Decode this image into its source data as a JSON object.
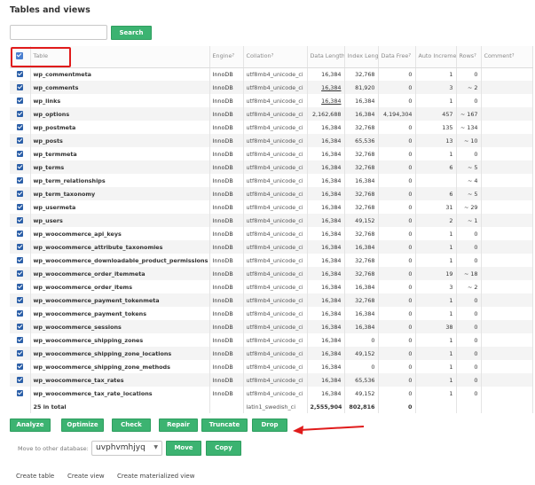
{
  "page": {
    "title": "Tables and views"
  },
  "search": {
    "value": "",
    "placeholder": "",
    "button_label": "Search"
  },
  "table": {
    "headers": {
      "table": "Table",
      "engine": "Engine",
      "collation": "Collation",
      "data_length": "Data Length",
      "index_length": "Index Length",
      "data_free": "Data Free",
      "auto_increment": "Auto Increment",
      "rows": "Rows",
      "comment": "Comment"
    },
    "rows": [
      {
        "name": "wp_commentmeta",
        "engine": "InnoDB",
        "collation": "utf8mb4_unicode_ci",
        "data_length": "16,384",
        "index_length": "32,768",
        "data_free": "0",
        "auto_increment": "1",
        "rows": "0",
        "comment": ""
      },
      {
        "name": "wp_comments",
        "engine": "InnoDB",
        "collation": "utf8mb4_unicode_ci",
        "data_length": "16,384",
        "index_length": "81,920",
        "data_free": "0",
        "auto_increment": "3",
        "rows": "~ 2",
        "comment": ""
      },
      {
        "name": "wp_links",
        "engine": "InnoDB",
        "collation": "utf8mb4_unicode_ci",
        "data_length": "16,384",
        "index_length": "16,384",
        "data_free": "0",
        "auto_increment": "1",
        "rows": "0",
        "comment": ""
      },
      {
        "name": "wp_options",
        "engine": "InnoDB",
        "collation": "utf8mb4_unicode_ci",
        "data_length": "2,162,688",
        "index_length": "16,384",
        "data_free": "4,194,304",
        "auto_increment": "457",
        "rows": "~ 167",
        "comment": ""
      },
      {
        "name": "wp_postmeta",
        "engine": "InnoDB",
        "collation": "utf8mb4_unicode_ci",
        "data_length": "16,384",
        "index_length": "32,768",
        "data_free": "0",
        "auto_increment": "135",
        "rows": "~ 134",
        "comment": ""
      },
      {
        "name": "wp_posts",
        "engine": "InnoDB",
        "collation": "utf8mb4_unicode_ci",
        "data_length": "16,384",
        "index_length": "65,536",
        "data_free": "0",
        "auto_increment": "13",
        "rows": "~ 10",
        "comment": ""
      },
      {
        "name": "wp_termmeta",
        "engine": "InnoDB",
        "collation": "utf8mb4_unicode_ci",
        "data_length": "16,384",
        "index_length": "32,768",
        "data_free": "0",
        "auto_increment": "1",
        "rows": "0",
        "comment": ""
      },
      {
        "name": "wp_terms",
        "engine": "InnoDB",
        "collation": "utf8mb4_unicode_ci",
        "data_length": "16,384",
        "index_length": "32,768",
        "data_free": "0",
        "auto_increment": "6",
        "rows": "~ 5",
        "comment": ""
      },
      {
        "name": "wp_term_relationships",
        "engine": "InnoDB",
        "collation": "utf8mb4_unicode_ci",
        "data_length": "16,384",
        "index_length": "16,384",
        "data_free": "0",
        "auto_increment": "",
        "rows": "~ 4",
        "comment": ""
      },
      {
        "name": "wp_term_taxonomy",
        "engine": "InnoDB",
        "collation": "utf8mb4_unicode_ci",
        "data_length": "16,384",
        "index_length": "32,768",
        "data_free": "0",
        "auto_increment": "6",
        "rows": "~ 5",
        "comment": ""
      },
      {
        "name": "wp_usermeta",
        "engine": "InnoDB",
        "collation": "utf8mb4_unicode_ci",
        "data_length": "16,384",
        "index_length": "32,768",
        "data_free": "0",
        "auto_increment": "31",
        "rows": "~ 29",
        "comment": ""
      },
      {
        "name": "wp_users",
        "engine": "InnoDB",
        "collation": "utf8mb4_unicode_ci",
        "data_length": "16,384",
        "index_length": "49,152",
        "data_free": "0",
        "auto_increment": "2",
        "rows": "~ 1",
        "comment": ""
      },
      {
        "name": "wp_woocommerce_api_keys",
        "engine": "InnoDB",
        "collation": "utf8mb4_unicode_ci",
        "data_length": "16,384",
        "index_length": "32,768",
        "data_free": "0",
        "auto_increment": "1",
        "rows": "0",
        "comment": ""
      },
      {
        "name": "wp_woocommerce_attribute_taxonomies",
        "engine": "InnoDB",
        "collation": "utf8mb4_unicode_ci",
        "data_length": "16,384",
        "index_length": "16,384",
        "data_free": "0",
        "auto_increment": "1",
        "rows": "0",
        "comment": ""
      },
      {
        "name": "wp_woocommerce_downloadable_product_permissions",
        "engine": "InnoDB",
        "collation": "utf8mb4_unicode_ci",
        "data_length": "16,384",
        "index_length": "32,768",
        "data_free": "0",
        "auto_increment": "1",
        "rows": "0",
        "comment": ""
      },
      {
        "name": "wp_woocommerce_order_itemmeta",
        "engine": "InnoDB",
        "collation": "utf8mb4_unicode_ci",
        "data_length": "16,384",
        "index_length": "32,768",
        "data_free": "0",
        "auto_increment": "19",
        "rows": "~ 18",
        "comment": ""
      },
      {
        "name": "wp_woocommerce_order_items",
        "engine": "InnoDB",
        "collation": "utf8mb4_unicode_ci",
        "data_length": "16,384",
        "index_length": "16,384",
        "data_free": "0",
        "auto_increment": "3",
        "rows": "~ 2",
        "comment": ""
      },
      {
        "name": "wp_woocommerce_payment_tokenmeta",
        "engine": "InnoDB",
        "collation": "utf8mb4_unicode_ci",
        "data_length": "16,384",
        "index_length": "32,768",
        "data_free": "0",
        "auto_increment": "1",
        "rows": "0",
        "comment": ""
      },
      {
        "name": "wp_woocommerce_payment_tokens",
        "engine": "InnoDB",
        "collation": "utf8mb4_unicode_ci",
        "data_length": "16,384",
        "index_length": "16,384",
        "data_free": "0",
        "auto_increment": "1",
        "rows": "0",
        "comment": ""
      },
      {
        "name": "wp_woocommerce_sessions",
        "engine": "InnoDB",
        "collation": "utf8mb4_unicode_ci",
        "data_length": "16,384",
        "index_length": "16,384",
        "data_free": "0",
        "auto_increment": "38",
        "rows": "0",
        "comment": ""
      },
      {
        "name": "wp_woocommerce_shipping_zones",
        "engine": "InnoDB",
        "collation": "utf8mb4_unicode_ci",
        "data_length": "16,384",
        "index_length": "0",
        "data_free": "0",
        "auto_increment": "1",
        "rows": "0",
        "comment": ""
      },
      {
        "name": "wp_woocommerce_shipping_zone_locations",
        "engine": "InnoDB",
        "collation": "utf8mb4_unicode_ci",
        "data_length": "16,384",
        "index_length": "49,152",
        "data_free": "0",
        "auto_increment": "1",
        "rows": "0",
        "comment": ""
      },
      {
        "name": "wp_woocommerce_shipping_zone_methods",
        "engine": "InnoDB",
        "collation": "utf8mb4_unicode_ci",
        "data_length": "16,384",
        "index_length": "0",
        "data_free": "0",
        "auto_increment": "1",
        "rows": "0",
        "comment": ""
      },
      {
        "name": "wp_woocommerce_tax_rates",
        "engine": "InnoDB",
        "collation": "utf8mb4_unicode_ci",
        "data_length": "16,384",
        "index_length": "65,536",
        "data_free": "0",
        "auto_increment": "1",
        "rows": "0",
        "comment": ""
      },
      {
        "name": "wp_woocommerce_tax_rate_locations",
        "engine": "InnoDB",
        "collation": "utf8mb4_unicode_ci",
        "data_length": "16,384",
        "index_length": "49,152",
        "data_free": "0",
        "auto_increment": "1",
        "rows": "0",
        "comment": ""
      }
    ],
    "total": {
      "label": "25 in total",
      "collation": "latin1_swedish_ci",
      "data_length": "2,555,904",
      "index_length": "802,816",
      "data_free": "0"
    }
  },
  "actions": {
    "analyze": "Analyze",
    "optimize": "Optimize",
    "check": "Check",
    "repair": "Repair",
    "truncate": "Truncate",
    "drop": "Drop"
  },
  "move": {
    "label": "Move to other database:",
    "selected_db": "uvphvmhjyq",
    "move_button": "Move",
    "copy_button": "Copy"
  },
  "links": {
    "create_table": "Create table",
    "create_view": "Create view",
    "create_materialized_view": "Create materialized view"
  },
  "colors": {
    "button_green": "#3cb371",
    "highlight_red": "#e01b1b",
    "checkbox_blue": "#2b5fa8"
  }
}
